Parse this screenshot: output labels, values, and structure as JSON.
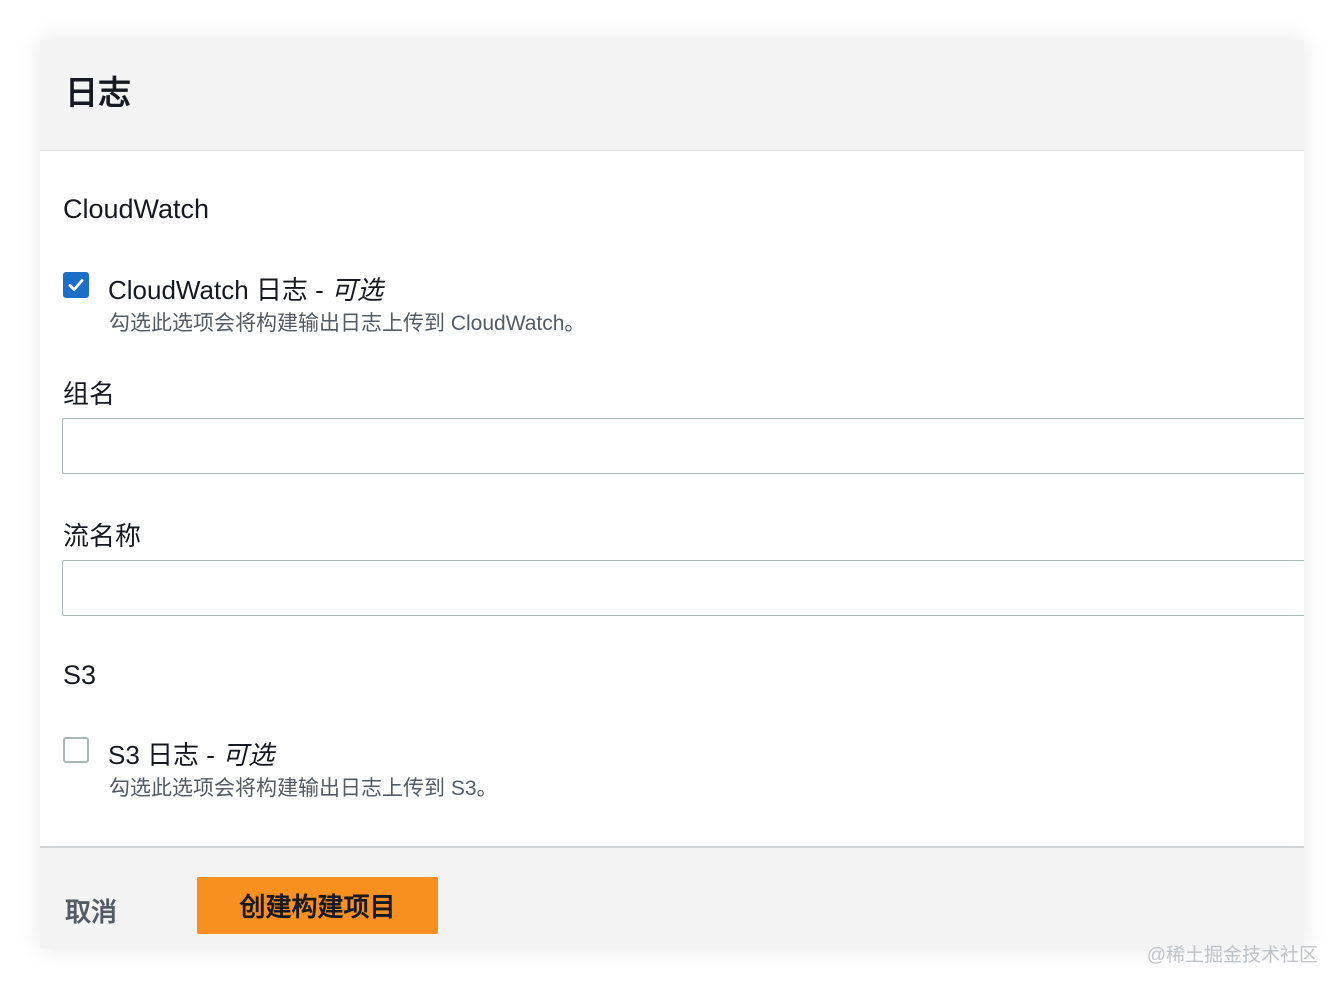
{
  "panel": {
    "title": "日志"
  },
  "cloudwatch": {
    "section_title": "CloudWatch",
    "checkbox": {
      "checked": true,
      "label": "CloudWatch 日志 - ",
      "optional": "可选",
      "description": "勾选此选项会将构建输出日志上传到 CloudWatch。"
    },
    "group_name": {
      "label": "组名",
      "value": ""
    },
    "stream_name": {
      "label": "流名称",
      "value": ""
    }
  },
  "s3": {
    "section_title": "S3",
    "checkbox": {
      "checked": false,
      "label": "S3 日志 - ",
      "optional": "可选",
      "description": "勾选此选项会将构建输出日志上传到 S3。"
    }
  },
  "footer": {
    "cancel_label": "取消",
    "create_label": "创建构建项目"
  },
  "watermark": "@稀土掘金技术社区",
  "colors": {
    "accent_orange": "#f7901e",
    "checkbox_blue": "#1c6fc9"
  }
}
